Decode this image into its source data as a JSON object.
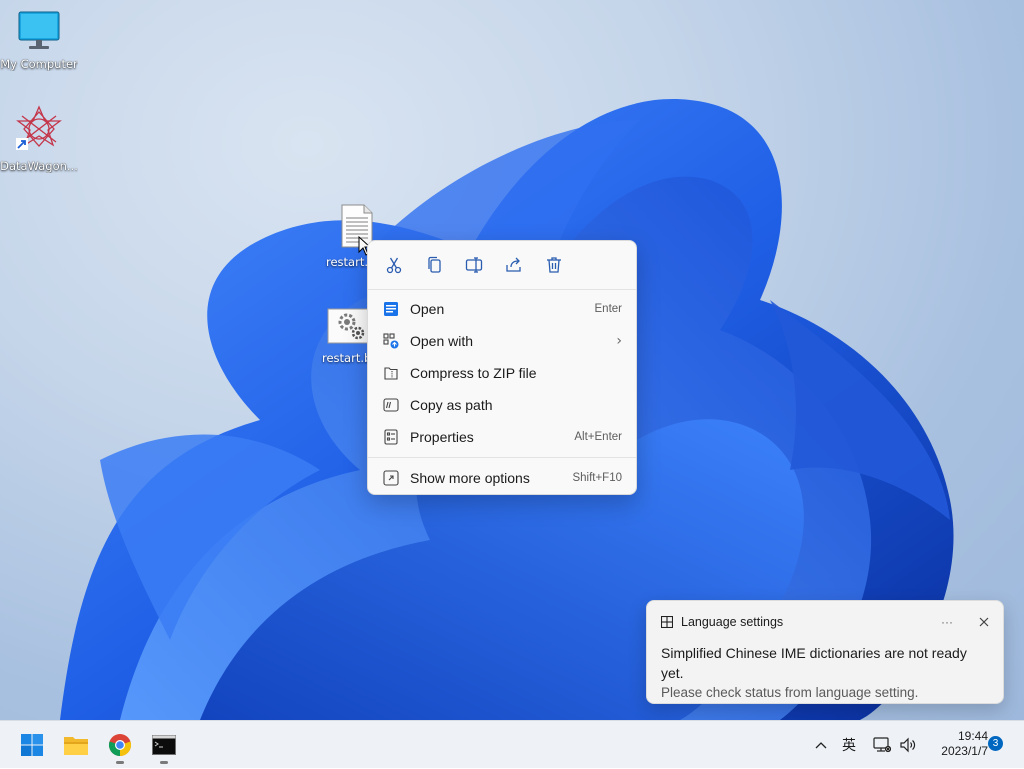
{
  "desktop": {
    "icons": [
      {
        "label": "My Computer",
        "icon": "monitor-icon"
      },
      {
        "label": "DataWagon...",
        "icon": "datawagon-icon"
      }
    ],
    "files": [
      {
        "label": "restart.t",
        "icon": "text-file-icon"
      },
      {
        "label": "restart.b",
        "icon": "batch-file-icon"
      }
    ]
  },
  "context_menu": {
    "toolbar": [
      "cut-icon",
      "copy-icon",
      "rename-icon",
      "share-icon",
      "delete-icon"
    ],
    "items": [
      {
        "label": "Open",
        "shortcut": "Enter",
        "icon": "open-icon"
      },
      {
        "label": "Open with",
        "shortcut": "",
        "icon": "open-with-icon",
        "has_submenu": true
      },
      {
        "label": "Compress to ZIP file",
        "shortcut": "",
        "icon": "zip-icon"
      },
      {
        "label": "Copy as path",
        "shortcut": "",
        "icon": "copy-path-icon"
      },
      {
        "label": "Properties",
        "shortcut": "Alt+Enter",
        "icon": "properties-icon"
      },
      {
        "label": "Show more options",
        "shortcut": "Shift+F10",
        "icon": "more-options-icon"
      }
    ]
  },
  "toast": {
    "title": "Language settings",
    "more": "···",
    "line1": "Simplified Chinese IME dictionaries are not ready yet.",
    "line2": "Please check status from language setting."
  },
  "taskbar": {
    "apps": [
      "start-icon",
      "file-explorer-icon",
      "chrome-icon",
      "terminal-icon"
    ],
    "ime": "英",
    "time": "19:44",
    "date": "2023/1/7",
    "notifications": "3"
  }
}
